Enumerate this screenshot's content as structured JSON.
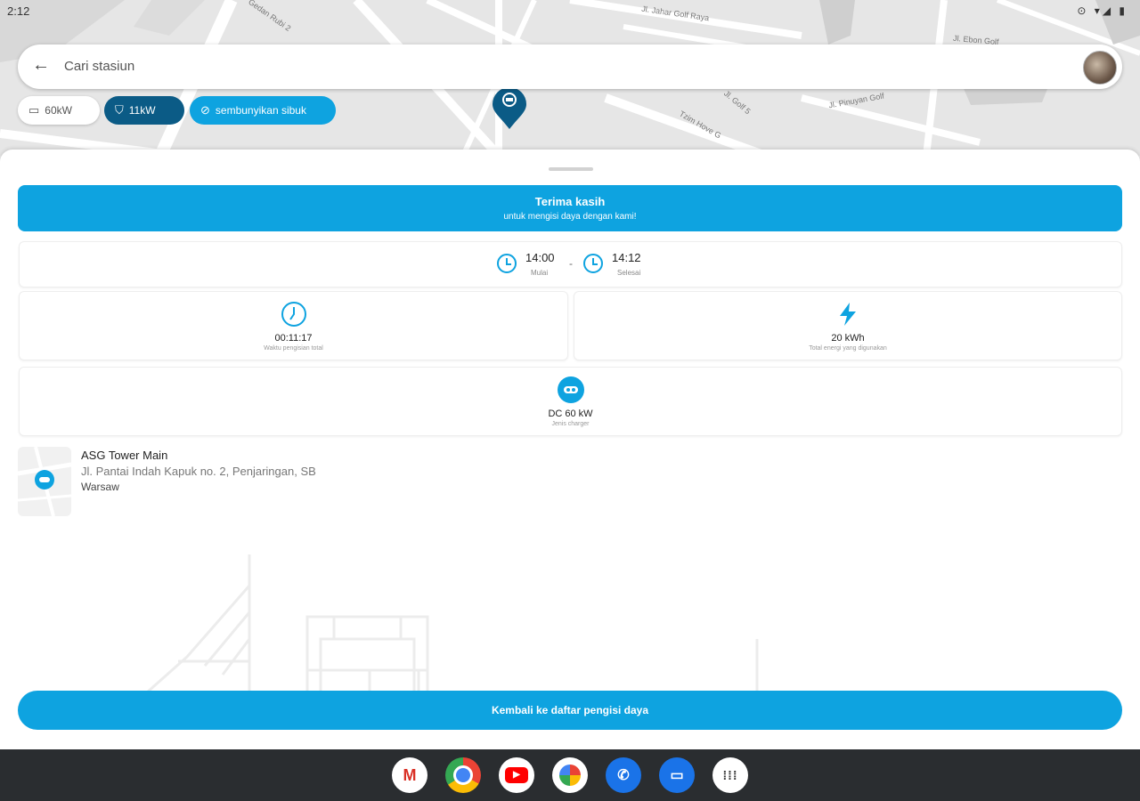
{
  "status_bar": {
    "time": "2:12",
    "icons": "⊙ ▾◢ ▮"
  },
  "map": {
    "street_labels": [
      "Gedan Rubi 2",
      "Jl. Jahar Golf Raya",
      "Jl. Ebon Golf",
      "Jl. Pinuyan Golf",
      "Jl. Golf 5",
      "Tzim Hove G"
    ]
  },
  "search": {
    "placeholder": "Cari stasiun"
  },
  "filters": {
    "chip_60kw": "60kW",
    "chip_11kw": "11kW",
    "chip_hide_busy": "sembunyikan sibuk"
  },
  "banner": {
    "title": "Terima kasih",
    "subtitle": "untuk mengisi daya dengan kami!"
  },
  "times": {
    "start_value": "14:00",
    "start_label": "Mulai",
    "separator": "-",
    "end_value": "14:12",
    "end_label": "Selesai"
  },
  "stats": {
    "duration_value": "00:11:17",
    "duration_label": "Waktu pengisian total",
    "energy_value": "20 kWh",
    "energy_label": "Total energi yang digunakan",
    "connector_value": "DC 60 kW",
    "connector_label": "Jenis charger"
  },
  "station": {
    "name": "ASG Tower Main",
    "address": "Jl. Pantai Indah Kapuk no. 2, Penjaringan, SB",
    "city": "Warsaw"
  },
  "back_button": "Kembali ke daftar pengisi daya",
  "dock": {
    "apps": [
      "gmail-icon",
      "chrome-icon",
      "youtube-icon",
      "photos-icon",
      "phone-icon",
      "messages-icon",
      "app-drawer-icon"
    ]
  },
  "colors": {
    "accent": "#0ea3e0",
    "chip_dark": "#0b5b86",
    "dock_bg": "#2a2d30"
  }
}
